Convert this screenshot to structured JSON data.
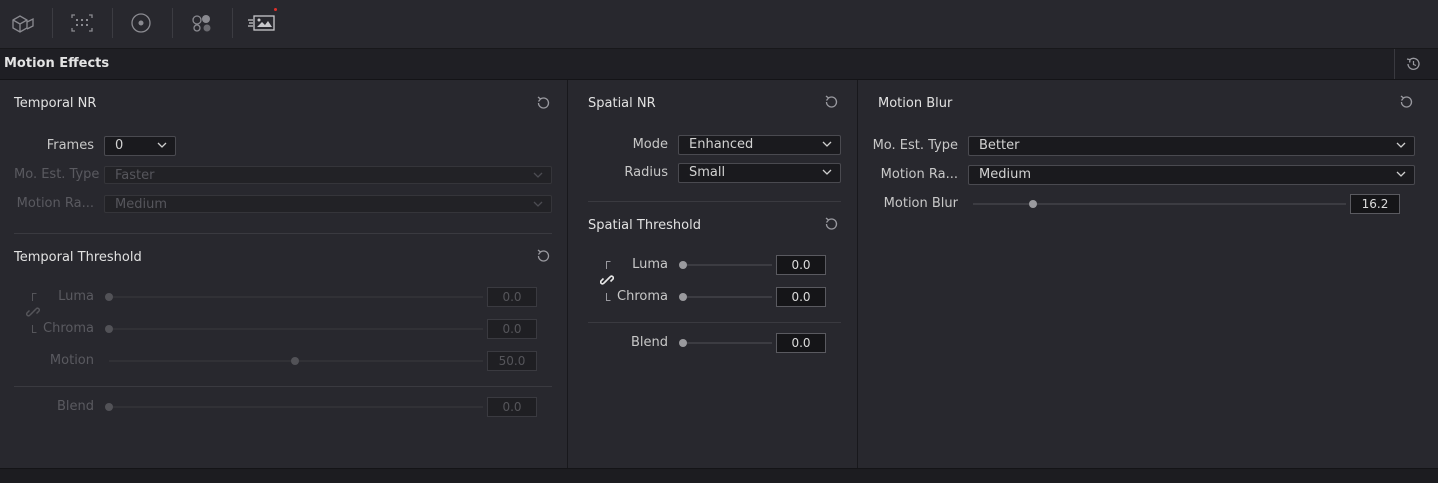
{
  "toolbar": {
    "icons": [
      "3d-cube-icon",
      "grid-select-icon",
      "target-circle-icon",
      "nodes-icon",
      "motion-effects-icon"
    ]
  },
  "header": {
    "title": "Motion Effects"
  },
  "temporal_nr": {
    "title": "Temporal NR",
    "frames_label": "Frames",
    "frames_value": "0",
    "mo_est_type_label": "Mo. Est. Type",
    "mo_est_type_value": "Faster",
    "motion_range_label": "Motion Ra...",
    "motion_range_value": "Medium"
  },
  "temporal_threshold": {
    "title": "Temporal Threshold",
    "luma_label": "Luma",
    "luma_value": "0.0",
    "luma_level": 0.0,
    "chroma_label": "Chroma",
    "chroma_value": "0.0",
    "chroma_level": 0.0,
    "motion_label": "Motion",
    "motion_value": "50.0",
    "motion_level": 0.5,
    "blend_label": "Blend",
    "blend_value": "0.0",
    "blend_level": 0.0
  },
  "spatial_nr": {
    "title": "Spatial NR",
    "mode_label": "Mode",
    "mode_value": "Enhanced",
    "radius_label": "Radius",
    "radius_value": "Small"
  },
  "spatial_threshold": {
    "title": "Spatial Threshold",
    "luma_label": "Luma",
    "luma_value": "0.0",
    "luma_level": 0.0,
    "chroma_label": "Chroma",
    "chroma_value": "0.0",
    "chroma_level": 0.0,
    "blend_label": "Blend",
    "blend_value": "0.0",
    "blend_level": 0.0
  },
  "motion_blur": {
    "title": "Motion Blur",
    "mo_est_type_label": "Mo. Est. Type",
    "mo_est_type_value": "Better",
    "motion_range_label": "Motion Ra...",
    "motion_range_value": "Medium",
    "blur_label": "Motion Blur",
    "blur_value": "16.2",
    "blur_level": 0.162
  },
  "colors": {
    "background": "#28282e",
    "header": "#1f1f24",
    "indicator_dot": "#e0302a"
  }
}
